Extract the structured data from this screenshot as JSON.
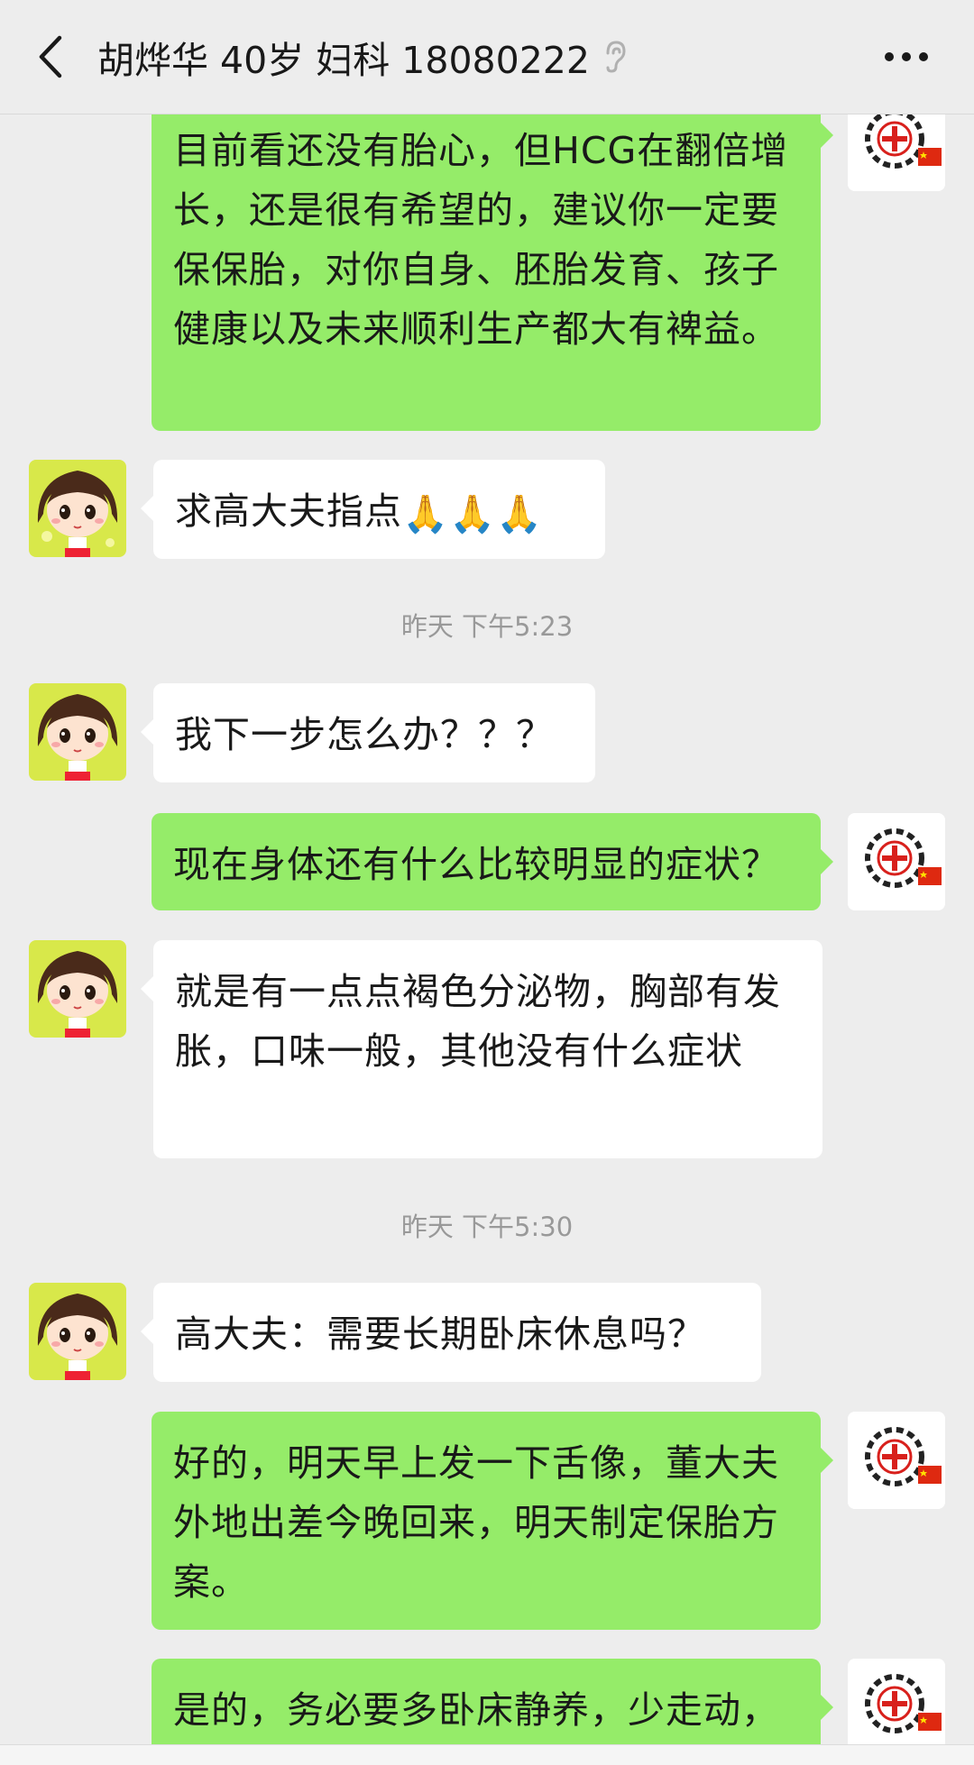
{
  "header": {
    "title": "胡烨华 40岁 妇科 18080222",
    "back_icon": "chevron-left-icon",
    "ear_icon": "ear-icon",
    "more_icon": "more-dots-icon"
  },
  "messages": [
    {
      "side": "right",
      "text": "目前看还没有胎心，但HCG在翻倍增长，还是很有希望的，建议你一定要保保胎，对你自身、胚胎发育、孩子健康以及未来顺利生产都大有裨益。"
    },
    {
      "side": "left",
      "text": "求高大夫指点",
      "emoji": "🙏🙏🙏"
    },
    {
      "time": "昨天 下午5:23"
    },
    {
      "side": "left",
      "text": "我下一步怎么办？？？"
    },
    {
      "side": "right",
      "text": "现在身体还有什么比较明显的症状？"
    },
    {
      "side": "left",
      "text": "就是有一点点褐色分泌物，胸部有发胀，口味一般，其他没有什么症状"
    },
    {
      "time": "昨天 下午5:30"
    },
    {
      "side": "left",
      "text": "高大夫：需要长期卧床休息吗？"
    },
    {
      "side": "right",
      "text": "好的，明天早上发一下舌像，董大夫外地出差今晚回来，明天制定保胎方案。"
    },
    {
      "side": "right",
      "text": "是的，务必要多卧床静养，少走动，"
    }
  ],
  "colors": {
    "green_bubble": "#95ec69",
    "white_bubble": "#ffffff",
    "background": "#ededed",
    "time_text": "#999999"
  }
}
